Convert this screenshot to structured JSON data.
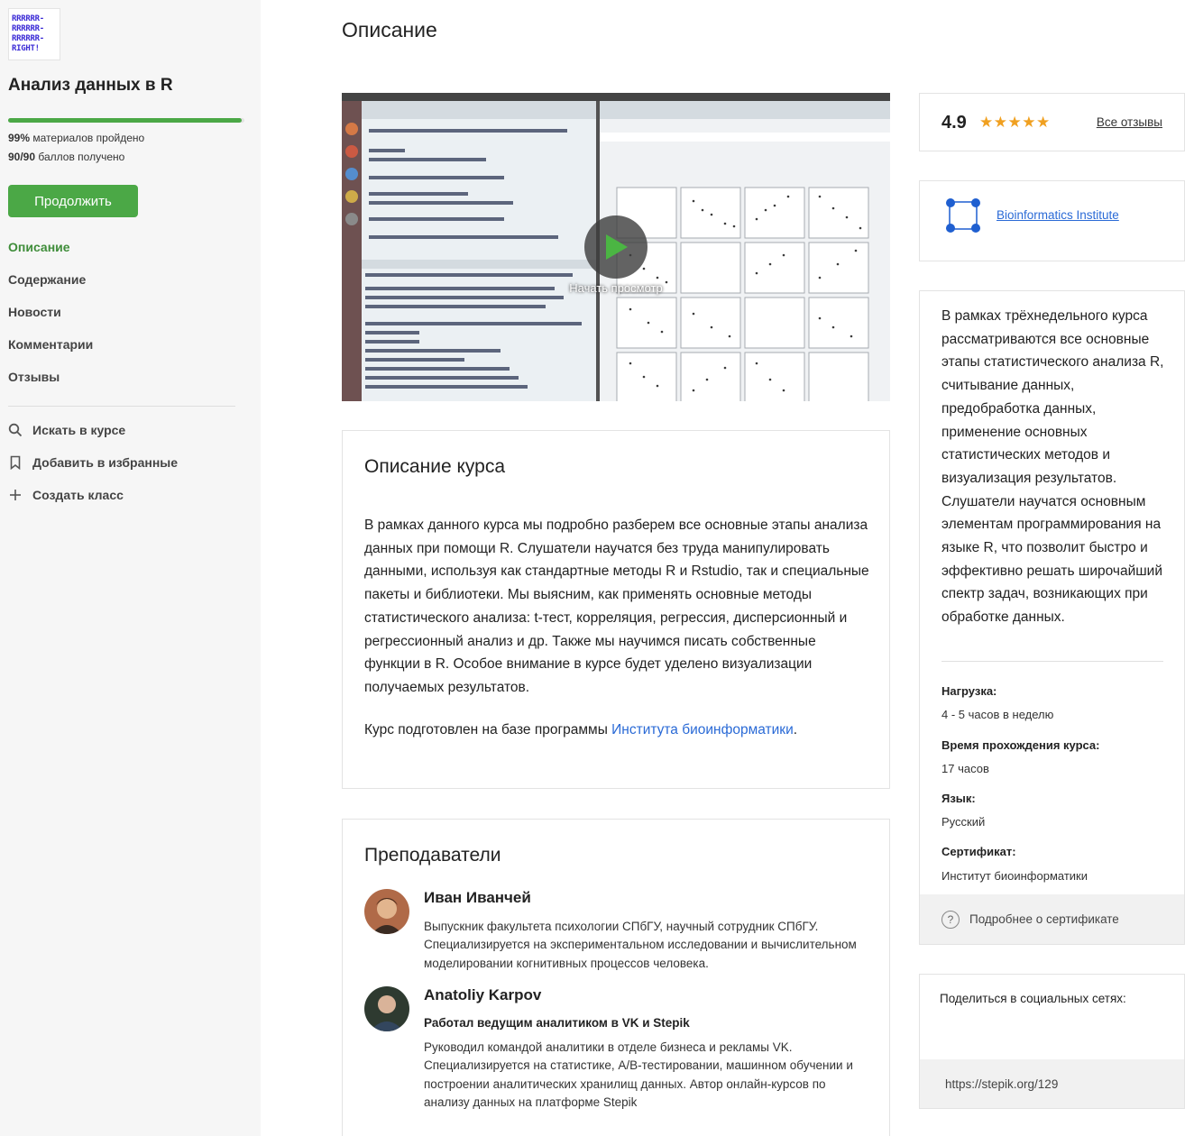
{
  "course": {
    "logo_lines": [
      "RRRRRR-",
      "RRRRRR-",
      "RRRRRR-",
      "RIGHT!"
    ],
    "title": "Анализ данных в R",
    "progress_fraction": 0.99,
    "materials_value": "99%",
    "materials_text": "материалов пройдено",
    "points_value": "90/90",
    "points_text": "баллов получено",
    "continue_label": "Продолжить"
  },
  "sidebar": {
    "nav": [
      {
        "label": "Описание",
        "active": true
      },
      {
        "label": "Содержание",
        "active": false
      },
      {
        "label": "Новости",
        "active": false
      },
      {
        "label": "Комментарии",
        "active": false
      },
      {
        "label": "Отзывы",
        "active": false
      }
    ],
    "actions": [
      {
        "label": "Искать в курсе",
        "icon": "search-icon"
      },
      {
        "label": "Добавить в избранные",
        "icon": "bookmark-icon"
      },
      {
        "label": "Создать класс",
        "icon": "plus-icon"
      }
    ]
  },
  "main": {
    "page_title": "Описание",
    "video": {
      "caption": "Начать просмотр"
    },
    "description": {
      "title": "Описание курса",
      "text": "В рамках данного курса мы подробно разберем все основные этапы анализа данных при помощи R. Слушатели научатся без труда манипулировать данными, используя как стандартные методы R и Rstudio, так и специальные пакеты и библиотеки. Мы выясним, как применять основные методы статистического анализа: t-тест, корреляция, регрессия, дисперсионный и регрессионный анализ и др. Также мы научимся писать собственные функции в R. Особое внимание в курсе будет уделено визуализации получаемых результатов.",
      "footer_prefix": "Курс подготовлен на базе программы ",
      "footer_link": "Института биоинформатики",
      "footer_suffix": "."
    },
    "teachers": {
      "title": "Преподаватели",
      "list": [
        {
          "name": "Иван Иванчей",
          "subtitle": "",
          "bio": "Выпускник факультета психологии СПбГУ, научный сотрудник СПбГУ. Специализируется на экспериментальном исследовании и вычислительном моделировании когнитивных процессов человека."
        },
        {
          "name": "Anatoliy Karpov",
          "subtitle": "Работал ведущим аналитиком в VK и Stepik",
          "bio": "Руководил командой аналитики в отделе бизнеса и рекламы VK. Специализируется на статистике, A/B-тестировании, машинном обучении и построении аналитических хранилищ данных. Автор онлайн-курсов по анализу данных на платформе Stepik"
        }
      ]
    }
  },
  "right": {
    "rating": {
      "value": "4.9",
      "stars": "★★★★★",
      "all_reviews": "Все отзывы"
    },
    "institute": {
      "name": "Bioinformatics Institute"
    },
    "about": "В рамках трёхнедельного курса рассматриваются все основные этапы статистического анализа R, считывание данных, предобработка данных, применение основных статистических методов и визуализация результатов. Слушатели научатся основным элементам программирования на языке R, что позволит быстро и эффективно решать широчайший спектр задач, возникающих при обработке данных.",
    "meta": [
      {
        "label": "Нагрузка:",
        "value": "4 - 5 часов в неделю"
      },
      {
        "label": "Время прохождения курса:",
        "value": "17 часов"
      },
      {
        "label": "Язык:",
        "value": "Русский"
      },
      {
        "label": "Сертификат:",
        "value": "Институт биоинформатики"
      }
    ],
    "certificate_link": "Подробнее о сертификате",
    "share": {
      "label": "Поделиться в социальных сетях:",
      "url": "https://stepik.org/129"
    }
  },
  "colors": {
    "accent_green": "#4ba846",
    "link_blue": "#2a6ad6",
    "star": "#f0a020",
    "logo_purple": "#3b2bd6"
  }
}
